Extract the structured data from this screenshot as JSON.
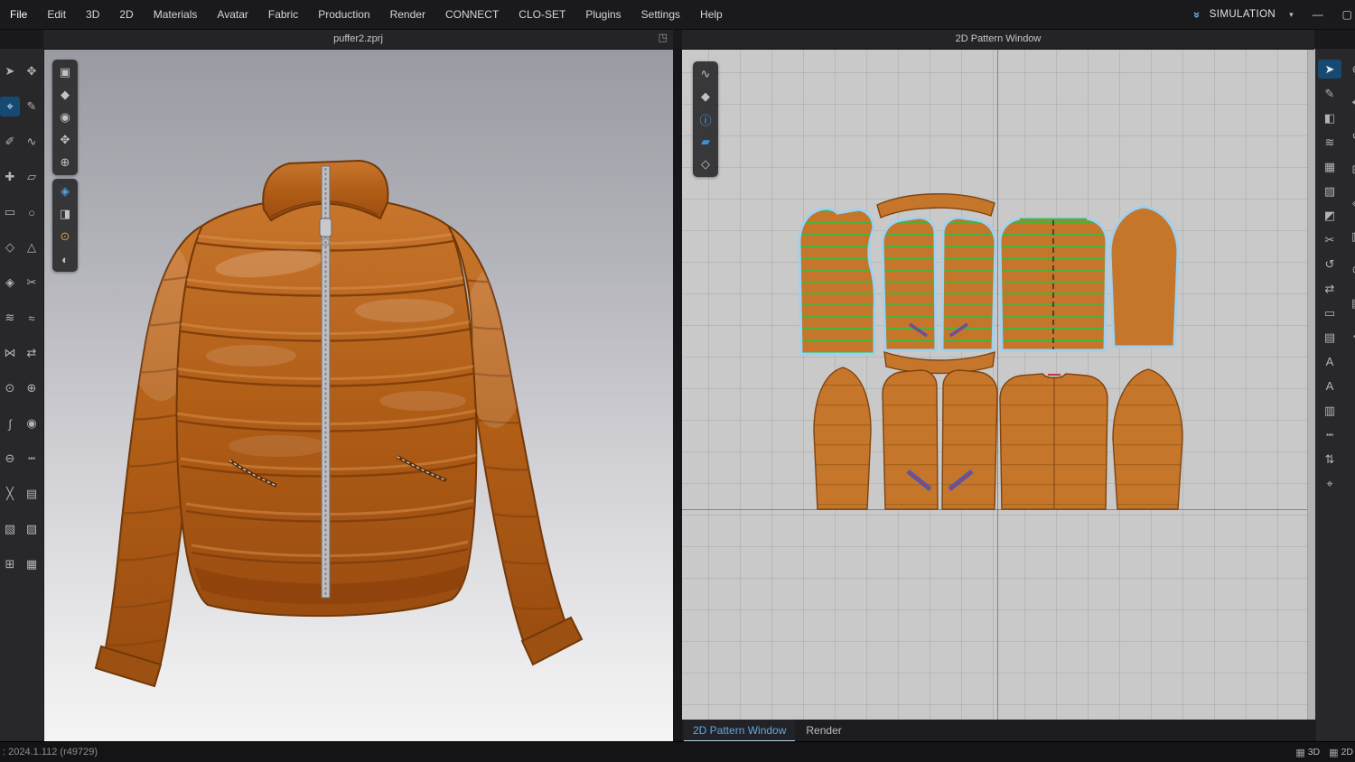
{
  "menu_bar": {
    "items": [
      {
        "name": "menu-file",
        "label": "File"
      },
      {
        "name": "menu-edit",
        "label": "Edit"
      },
      {
        "name": "menu-3d",
        "label": "3D"
      },
      {
        "name": "menu-2d",
        "label": "2D"
      },
      {
        "name": "menu-materials",
        "label": "Materials"
      },
      {
        "name": "menu-avatar",
        "label": "Avatar"
      },
      {
        "name": "menu-fabric",
        "label": "Fabric"
      },
      {
        "name": "menu-production",
        "label": "Production"
      },
      {
        "name": "menu-render",
        "label": "Render"
      },
      {
        "name": "menu-connect",
        "label": "CONNECT"
      },
      {
        "name": "menu-clo-set",
        "label": "CLO-SET"
      },
      {
        "name": "menu-plugins",
        "label": "Plugins"
      },
      {
        "name": "menu-settings",
        "label": "Settings"
      },
      {
        "name": "menu-help",
        "label": "Help"
      }
    ],
    "simulation_label": "SIMULATION",
    "controls": {
      "chevrons": "»",
      "caret": "▾",
      "minimize": "—",
      "restore": "▢"
    }
  },
  "panel_titles": {
    "viewport3d": "puffer2.zprj",
    "pattern2d": "2D Pattern Window",
    "undock_icon": "◳"
  },
  "left_toolbar": [
    {
      "name": "select-tool-icon",
      "glyph": "➤"
    },
    {
      "name": "avatar-walk-icon",
      "glyph": "✥"
    },
    {
      "name": "transform-pattern-icon",
      "glyph": "⌖",
      "active": true
    },
    {
      "name": "edit-pattern-icon",
      "glyph": "✎"
    },
    {
      "name": "edit-point-icon",
      "glyph": "✐"
    },
    {
      "name": "edit-curvature-icon",
      "glyph": "∿"
    },
    {
      "name": "add-point-icon",
      "glyph": "✚"
    },
    {
      "name": "polygon-tool-icon",
      "glyph": "▱"
    },
    {
      "name": "rectangle-tool-icon",
      "glyph": "▭"
    },
    {
      "name": "circle-tool-icon",
      "glyph": "○"
    },
    {
      "name": "dart-tool-icon",
      "glyph": "◇"
    },
    {
      "name": "notch-tool-icon",
      "glyph": "△"
    },
    {
      "name": "trace-tool-icon",
      "glyph": "◈"
    },
    {
      "name": "cut-tool-icon",
      "glyph": "✂"
    },
    {
      "name": "segment-sewing-icon",
      "glyph": "≋"
    },
    {
      "name": "free-sewing-icon",
      "glyph": "≈"
    },
    {
      "name": "sewing-check-icon",
      "glyph": "⋈"
    },
    {
      "name": "fold-arrangement-icon",
      "glyph": "⇄"
    },
    {
      "name": "pin-tool-icon",
      "glyph": "⊙"
    },
    {
      "name": "tack-tool-icon",
      "glyph": "⊕"
    },
    {
      "name": "zipper-tool-icon",
      "glyph": "∫"
    },
    {
      "name": "button-tool-icon",
      "glyph": "◉"
    },
    {
      "name": "buttonhole-tool-icon",
      "glyph": "⊖"
    },
    {
      "name": "topstitch-tool-icon",
      "glyph": "┅"
    },
    {
      "name": "basting-tool-icon",
      "glyph": "╳"
    },
    {
      "name": "measure-tape-icon",
      "glyph": "▤"
    },
    {
      "name": "grading-tool-icon",
      "glyph": "▧"
    },
    {
      "name": "texture-editor-icon",
      "glyph": "▨"
    },
    {
      "name": "print-layout-icon",
      "glyph": "⊞"
    },
    {
      "name": "fabric-strip-icon",
      "glyph": "▦"
    }
  ],
  "viewport_toolbar_a": [
    {
      "name": "view-cube-icon",
      "glyph": "▣"
    },
    {
      "name": "show-garment-icon",
      "glyph": "◆"
    },
    {
      "name": "show-avatar-icon",
      "glyph": "◉"
    },
    {
      "name": "gizmo-icon",
      "glyph": "✥"
    },
    {
      "name": "avatar-size-icon",
      "glyph": "⊕"
    }
  ],
  "viewport_toolbar_b": [
    {
      "name": "show-clothes-icon",
      "glyph": "◈",
      "color": "#4aa3e8"
    },
    {
      "name": "show-pattern-3d-icon",
      "glyph": "◨"
    },
    {
      "name": "avatar-display-icon",
      "glyph": "⊙",
      "color": "#d79b4a"
    },
    {
      "name": "environment-globe-icon",
      "glyph": "◐"
    }
  ],
  "pattern_toolbar": [
    {
      "name": "edit-2d-stitch-icon",
      "glyph": "∿"
    },
    {
      "name": "show-garment-2d-icon",
      "glyph": "◆"
    },
    {
      "name": "pattern-info-icon",
      "glyph": "ⓘ",
      "color": "#57a8e8"
    },
    {
      "name": "show-fabric-icon",
      "glyph": "▰",
      "color": "#3f8fd9"
    },
    {
      "name": "show-base-pattern-icon",
      "glyph": "◇"
    }
  ],
  "right_toolbar": [
    {
      "name": "select-2d-icon",
      "glyph": "➤",
      "active": true
    },
    {
      "name": "edit-sewing-icon",
      "glyph": "✎"
    },
    {
      "name": "pattern-3d-sync-icon",
      "glyph": "◧"
    },
    {
      "name": "show-sewing-icon",
      "glyph": "≋"
    },
    {
      "name": "show-grid-icon",
      "glyph": "▦"
    },
    {
      "name": "show-pattern-mesh-icon",
      "glyph": "▨"
    },
    {
      "name": "colorway-icon",
      "glyph": "◩"
    },
    {
      "name": "cut-pattern-icon",
      "glyph": "✂"
    },
    {
      "name": "reset-arrangement-icon",
      "glyph": "↺"
    },
    {
      "name": "mirror-pattern-icon",
      "glyph": "⇄"
    },
    {
      "name": "show-seamline-icon",
      "glyph": "▭"
    },
    {
      "name": "layer-icon",
      "glyph": "▤"
    },
    {
      "name": "annotation-text-icon",
      "glyph": "A"
    },
    {
      "name": "pattern-annotation-icon",
      "glyph": "A"
    },
    {
      "name": "ruler-icon",
      "glyph": "▥"
    },
    {
      "name": "show-topstitch-icon",
      "glyph": "┅"
    },
    {
      "name": "flip-vertical-icon",
      "glyph": "⇅"
    },
    {
      "name": "measure-2d-icon",
      "glyph": "⌖"
    }
  ],
  "right_edge_toolbar": [
    {
      "name": "zoom-tool-icon",
      "glyph": "⊕"
    },
    {
      "name": "pan-tool-icon",
      "glyph": "✥"
    },
    {
      "name": "rotate-view-icon",
      "glyph": "↺"
    },
    {
      "name": "fit-view-icon",
      "glyph": "⊞"
    },
    {
      "name": "snap-icon",
      "glyph": "◈"
    },
    {
      "name": "guide-icon",
      "glyph": "▥"
    },
    {
      "name": "lock-icon",
      "glyph": "⊙"
    },
    {
      "name": "options-icon",
      "glyph": "▤"
    },
    {
      "name": "more-tools-icon",
      "glyph": "┅"
    }
  ],
  "bottom_tabs": [
    {
      "name": "tab-2d-pattern-window",
      "label": "2D Pattern Window",
      "active": true
    },
    {
      "name": "tab-render",
      "label": "Render"
    }
  ],
  "status_bar": {
    "version": ": 2024.1.112 (r49729)",
    "badges": [
      {
        "name": "badge-3d-window",
        "icon": "▦",
        "label": "3D"
      },
      {
        "name": "badge-2d-window",
        "icon": "▦",
        "label": "2D"
      }
    ]
  },
  "colors": {
    "accent_blue": "#4aa3e8",
    "selected_outline_blue": "#9fd0f0",
    "stitch_green": "#46b33c",
    "pattern_orange": "#c5762b",
    "pattern_edge": "#7e430e",
    "jacket_orange": "#b05d16",
    "pocket_mark_blue": "#3a5fc8",
    "pocket_mark_red": "#c03a3a"
  }
}
